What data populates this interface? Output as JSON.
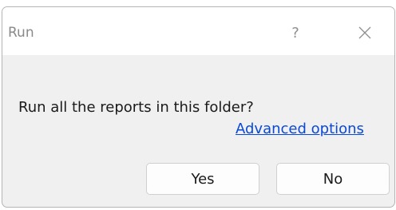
{
  "window": {
    "title": "Run",
    "help_glyph": "?",
    "close_icon": "close-icon"
  },
  "content": {
    "message": "Run all the reports in this folder?",
    "link_text": "Advanced options"
  },
  "buttons": {
    "yes_label": "Yes",
    "no_label": "No"
  },
  "colors": {
    "link": "#0a49d8",
    "dialog_background": "#f0f0f0",
    "titlebar_background": "#ffffff"
  }
}
